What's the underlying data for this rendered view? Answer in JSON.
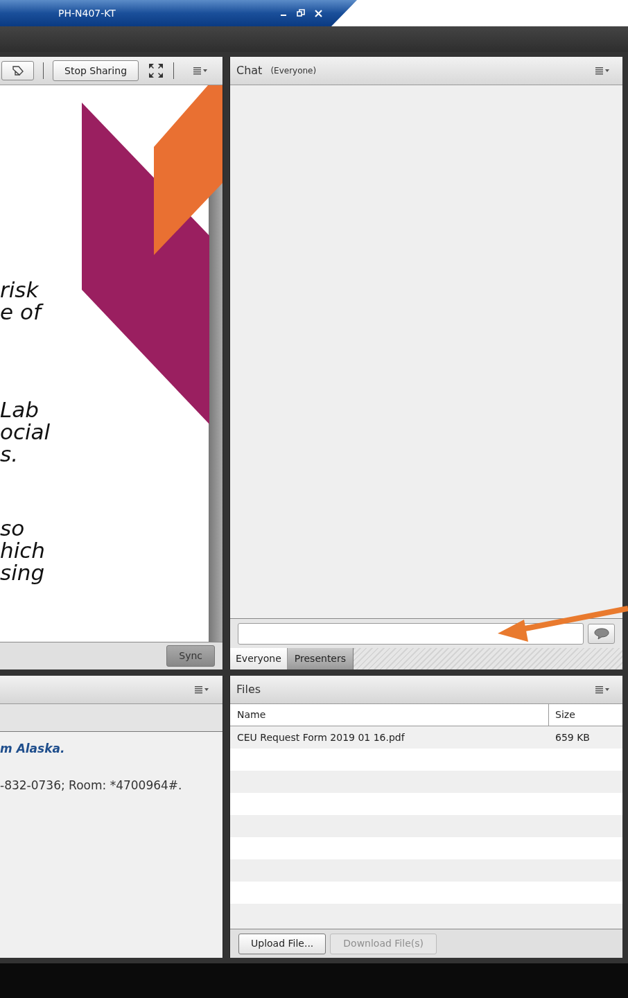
{
  "window": {
    "title": "PH-N407-KT"
  },
  "share_pod": {
    "stop_button": "Stop Sharing",
    "slide_paragraphs": [
      {
        "lines": [
          "risk",
          "e of"
        ]
      },
      {
        "lines": [
          "Lab",
          "ocial",
          "s."
        ]
      },
      {
        "lines": [
          "so",
          "hich",
          "sing"
        ]
      }
    ],
    "sync_button": "Sync"
  },
  "chat_pod": {
    "title": "Chat",
    "audience": "(Everyone)",
    "tabs": [
      {
        "label": "Everyone",
        "selected": true
      },
      {
        "label": "Presenters",
        "selected": false
      }
    ]
  },
  "notes_pod": {
    "lines": [
      {
        "text": "m Alaska.",
        "kind": "emphasis"
      },
      {
        "text": "-832-0736; Room: *4700964#.",
        "kind": "plain"
      }
    ]
  },
  "files_pod": {
    "title": "Files",
    "columns": [
      "Name",
      "Size"
    ],
    "rows": [
      {
        "name": "CEU Request Form 2019 01 16.pdf",
        "size": "659 KB"
      }
    ],
    "buttons": [
      {
        "label": "Upload File...",
        "disabled": false
      },
      {
        "label": "Download File(s)",
        "disabled": true
      }
    ]
  }
}
